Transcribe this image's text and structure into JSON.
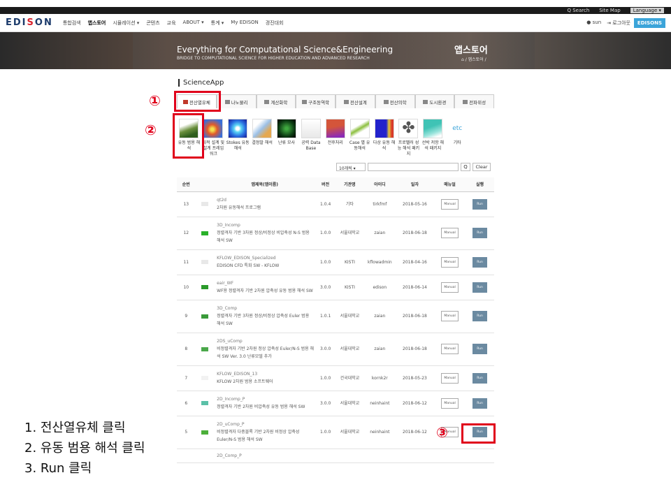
{
  "topbar": {
    "search": "Q Search",
    "sitemap": "Site Map",
    "language": "Language ▾"
  },
  "nav": {
    "logo_left": "EDI",
    "logo_accent": "S",
    "logo_right": "ON",
    "items": [
      "통합검색",
      "앱스토어",
      "시뮬레이션 ▾",
      "콘텐츠",
      "교육",
      "ABOUT ▾",
      "통계 ▾",
      "My EDISON",
      "경진대회"
    ],
    "user": "sun",
    "logout": "로그아웃",
    "edisons": "EDISONS"
  },
  "banner": {
    "title": "Everything for Computational Science&Engineering",
    "subtitle": "BRIDGE TO COMPUTATIONAL SCIENCE FOR HIGHER EDUCATION AND ADVANCED RESEARCH",
    "page_title": "앱스토어",
    "breadcrumb": "⌂ / 앱스토어 /"
  },
  "section": {
    "title": "ScienceApp"
  },
  "tabs": [
    "전산열유체",
    "나노물리",
    "계산화학",
    "구조동역학",
    "전산설계",
    "전산의학",
    "도시환경",
    "전파위성"
  ],
  "apps": [
    {
      "label": "유동 범용 해석",
      "color": "#6a8f3d"
    },
    {
      "label": "최적 설계 및 설계 프레임워크",
      "color": "#c84b3a"
    },
    {
      "label": "Stokes 유동 해석",
      "color": "#2a9de0"
    },
    {
      "label": "결정발 해석",
      "color": "#7aa3c8"
    },
    {
      "label": "난류 모사",
      "color": "#1a5a22"
    },
    {
      "label": "공력 Data Base",
      "color": "#e5e5e5"
    },
    {
      "label": "전후처리",
      "color": "#d4553a"
    },
    {
      "label": "Case 별 유동해석",
      "color": "#8cbf3f"
    },
    {
      "label": "다상 유동 해석",
      "color": "#4444cc"
    },
    {
      "label": "프로펠러 성능 해석 패키지",
      "color": "#666666"
    },
    {
      "label": "선박 저항 해석 패키지",
      "color": "#3fc3b5"
    },
    {
      "label": "기타",
      "color": "#ffffff",
      "text": "etc"
    }
  ],
  "search": {
    "page_size": "10개씩 ▾",
    "search_icon": "Q",
    "clear": "Clear"
  },
  "table": {
    "headers": [
      "순번",
      "",
      "앱제목(앱이름)",
      "버전",
      "기관명",
      "아이디",
      "일자",
      "매뉴얼",
      "실행"
    ],
    "manual_label": "Manual",
    "run_label": "Run",
    "rows": [
      {
        "no": "13",
        "icon": "#e8e8e8",
        "name": "qt2d",
        "desc": "2차원 유동해석 프로그램",
        "ver": "1.0.4",
        "org": "기타",
        "id": "tirkfmf",
        "date": "2018-05-16"
      },
      {
        "no": "12",
        "icon": "#2ab12a",
        "name": "3D_Incomp",
        "desc": "정렬격자 기반 3차원 정상/비정상 비압축성 N-S 범용 해석 SW",
        "ver": "1.0.0",
        "org": "서울대학교",
        "id": "zaian",
        "date": "2018-06-18"
      },
      {
        "no": "11",
        "icon": "#e8e8e8",
        "name": "KFLOW_EDISON_Specialized",
        "desc": "EDISON CFD 특화 SW - KFLOW",
        "ver": "1.0.0",
        "org": "KISTI",
        "id": "kflowadmin",
        "date": "2018-04-16"
      },
      {
        "no": "10",
        "icon": "#2a9a2a",
        "name": "eair_WF",
        "desc": "WF용 정렬격자 기반 2차원 압축성 유동 범용 해석 SW",
        "ver": "3.0.0",
        "org": "KISTI",
        "id": "edison",
        "date": "2018-06-14"
      },
      {
        "no": "9",
        "icon": "#3a9a3a",
        "name": "3D_Comp",
        "desc": "정렬격자 기반 3차원 정상/비정상 압축성 Euler 범용 해석 SW",
        "ver": "1.0.1",
        "org": "서울대학교",
        "id": "zaian",
        "date": "2018-06-18"
      },
      {
        "no": "8",
        "icon": "#4aa84a",
        "name": "2DS_uComp",
        "desc": "비정렬격자 기반 2차원 정상 압축성 Euler/N-S 범용 해석 SW Ver. 3.0 난류모델 추가",
        "ver": "3.0.0",
        "org": "서울대학교",
        "id": "zaian",
        "date": "2018-06-18"
      },
      {
        "no": "7",
        "icon": "#f2f2f2",
        "name": "KFLOW_EDISON_13",
        "desc": "KFLOW 2차원 범용 소프트웨어",
        "ver": "1.0.0",
        "org": "건국대학교",
        "id": "kornk2r",
        "date": "2018-05-23"
      },
      {
        "no": "6",
        "icon": "#5bc0a8",
        "name": "2D_Incomp_P",
        "desc": "정렬격자 기반 2차원 비압축성 유동 범용 해석 SW",
        "ver": "3.0.0",
        "org": "서울대학교",
        "id": "neinhaint",
        "date": "2018-06-12"
      },
      {
        "no": "5",
        "icon": "#4caf3a",
        "name": "2D_uComp_P",
        "desc": "비정렬격자 다중블록 기반 2차원 비정상 압축성 Euler/N-S 범용 해석 SW",
        "ver": "1.0.0",
        "org": "서울대학교",
        "id": "neinhaint",
        "date": "2018-06-12"
      },
      {
        "no": "",
        "icon": "",
        "name": "2D_Comp_P",
        "desc": "",
        "ver": "",
        "org": "",
        "id": "",
        "date": ""
      }
    ]
  },
  "annotations": {
    "markers": [
      "①",
      "②",
      "③"
    ],
    "notes": [
      "1. 전산열유체 클릭",
      "2. 유동 범용 해석 클릭",
      "3. Run 클릭"
    ]
  }
}
